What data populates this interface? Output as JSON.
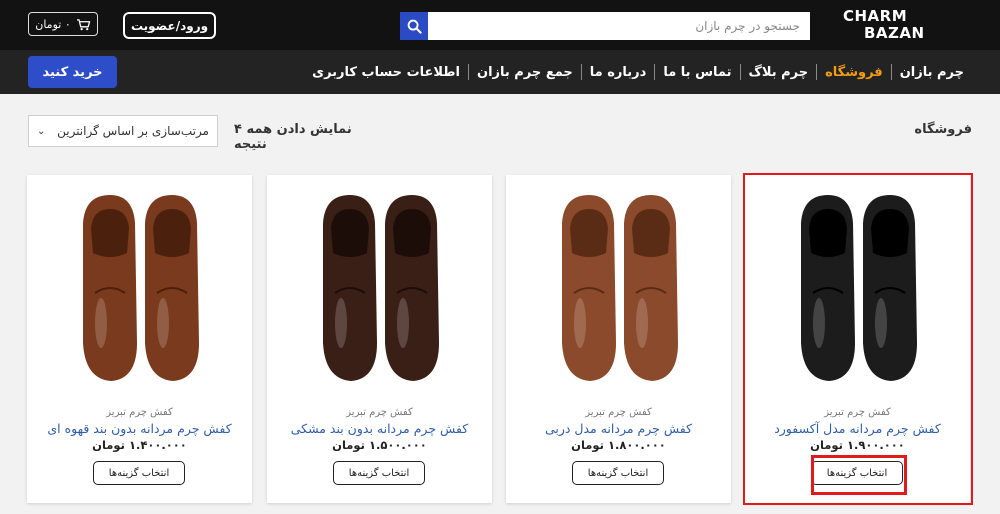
{
  "header": {
    "logo_line1": "CHARM",
    "logo_line2": "BAZAN",
    "search_placeholder": "جستجو در چرم بازان",
    "login_label": "ورود/عضویت",
    "cart_amount": "۰ تومان"
  },
  "nav": {
    "items": [
      {
        "label": "چرم بازان"
      },
      {
        "label": "فروشگاه",
        "active": true
      },
      {
        "label": "چرم بلاگ"
      },
      {
        "label": "تماس با ما"
      },
      {
        "label": "درباره ما"
      },
      {
        "label": "جمع چرم بازان"
      },
      {
        "label": "اطلاعات حساب کاربری"
      }
    ],
    "buy_label": "خرید کنید"
  },
  "shop": {
    "title": "فروشگاه",
    "result_count": "نمایش دادن همه ۴ نتیجه",
    "sort_label": "مرتب‌سازی بر اساس گرانترین"
  },
  "products": [
    {
      "brand": "کفش چرم تبریز",
      "title": "کفش چرم مردانه مدل آکسفورد",
      "price": "۱.۹۰۰.۰۰۰ تومان",
      "button": "انتخاب گزینه‌ها",
      "shoe_color": "#1c1c1c",
      "shoe_shade": "#000000"
    },
    {
      "brand": "کفش چرم تبریز",
      "title": "کفش چرم مردانه مدل دربی",
      "price": "۱.۸۰۰.۰۰۰ تومان",
      "button": "انتخاب گزینه‌ها",
      "shoe_color": "#8b4a2b",
      "shoe_shade": "#5a2c16"
    },
    {
      "brand": "کفش چرم تبریز",
      "title": "کفش چرم مردانه بدون بند مشکی",
      "price": "۱.۵۰۰.۰۰۰ تومان",
      "button": "انتخاب گزینه‌ها",
      "shoe_color": "#3a1f17",
      "shoe_shade": "#1d0d08"
    },
    {
      "brand": "کفش چرم تبریز",
      "title": "کفش چرم مردانه بدون بند قهوه ای",
      "price": "۱.۴۰۰.۰۰۰ تومان",
      "button": "انتخاب گزینه‌ها",
      "shoe_color": "#7a3a1d",
      "shoe_shade": "#4b200d"
    }
  ],
  "colors": {
    "header_bg": "#121212",
    "nav_bg": "#232323",
    "accent_orange": "#f39c12",
    "button_blue": "#2d4ec8",
    "link_blue": "#2f5ea8",
    "highlight_red": "#e11b1b"
  },
  "icons": {
    "search": "search-icon",
    "cart": "cart-icon",
    "chevron": "chevron-down-icon"
  }
}
